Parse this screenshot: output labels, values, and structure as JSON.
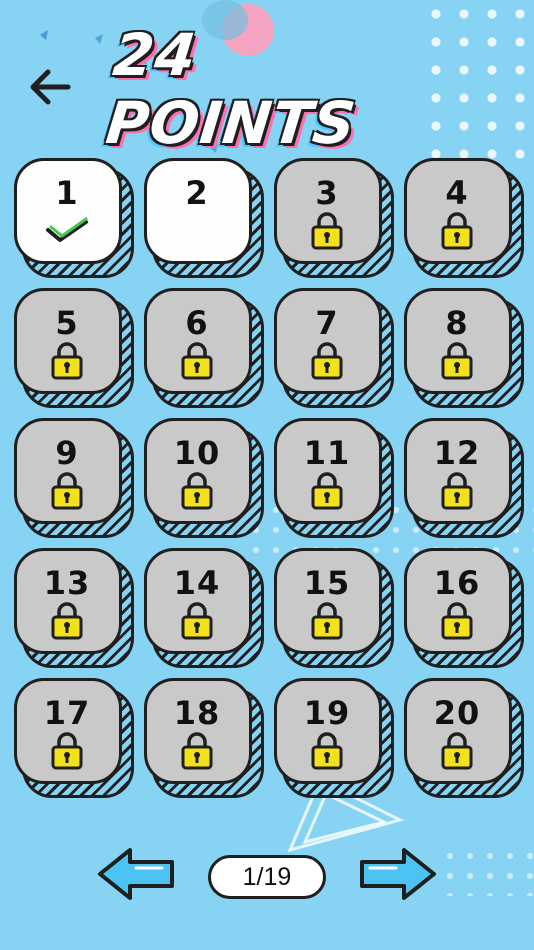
{
  "header": {
    "title": "24 POINTS",
    "back_icon": "back-arrow-icon"
  },
  "levels": [
    {
      "label": "1",
      "state": "completed"
    },
    {
      "label": "2",
      "state": "unlocked"
    },
    {
      "label": "3",
      "state": "locked"
    },
    {
      "label": "4",
      "state": "locked"
    },
    {
      "label": "5",
      "state": "locked"
    },
    {
      "label": "6",
      "state": "locked"
    },
    {
      "label": "7",
      "state": "locked"
    },
    {
      "label": "8",
      "state": "locked"
    },
    {
      "label": "9",
      "state": "locked"
    },
    {
      "label": "10",
      "state": "locked"
    },
    {
      "label": "11",
      "state": "locked"
    },
    {
      "label": "12",
      "state": "locked"
    },
    {
      "label": "13",
      "state": "locked"
    },
    {
      "label": "14",
      "state": "locked"
    },
    {
      "label": "15",
      "state": "locked"
    },
    {
      "label": "16",
      "state": "locked"
    },
    {
      "label": "17",
      "state": "locked"
    },
    {
      "label": "18",
      "state": "locked"
    },
    {
      "label": "19",
      "state": "locked"
    },
    {
      "label": "20",
      "state": "locked"
    }
  ],
  "pager": {
    "page_text": "1/19",
    "prev_icon": "left-arrow-icon",
    "next_icon": "right-arrow-icon"
  },
  "colors": {
    "background": "#86d3f3",
    "locked_tile": "#c9c9c9",
    "unlocked_tile": "#fdfdfd",
    "lock": "#f3e11a",
    "check": "#3ecb4f",
    "arrow_button": "#4cc3f2"
  }
}
